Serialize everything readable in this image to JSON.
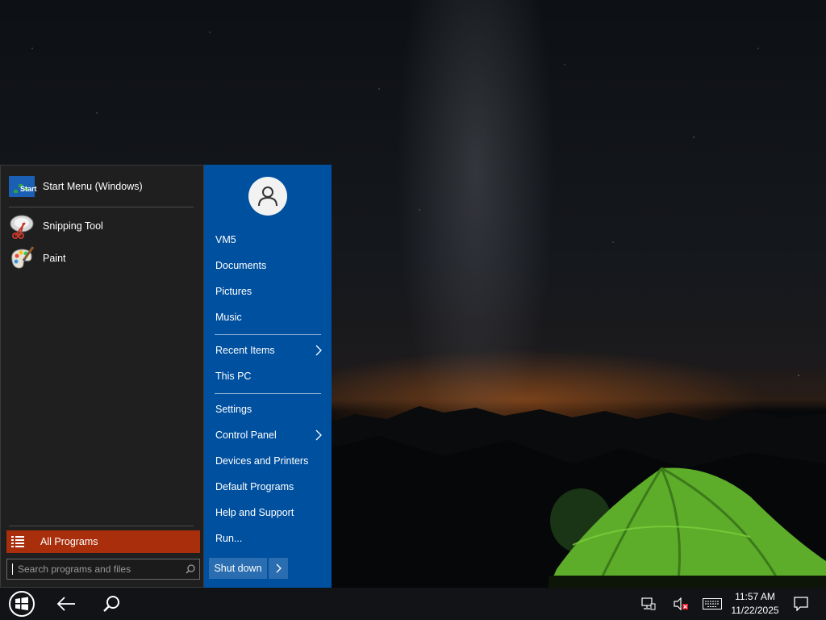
{
  "start_menu": {
    "pinned": [
      {
        "label": "Start Menu (Windows)",
        "icon": "start-menu-app-icon"
      },
      {
        "label": "Snipping Tool",
        "icon": "snipping-tool-icon"
      },
      {
        "label": "Paint",
        "icon": "paint-icon"
      }
    ],
    "start_icon_text": "Start",
    "all_programs_label": "All Programs",
    "search_placeholder": "Search programs and files",
    "right": {
      "user": "VM5",
      "items": [
        "Documents",
        "Pictures",
        "Music",
        "Recent Items",
        "This PC",
        "Settings",
        "Control Panel",
        "Devices and Printers",
        "Default Programs",
        "Help and Support",
        "Run..."
      ],
      "shutdown_label": "Shut down"
    }
  },
  "taskbar": {
    "time": "11:57 AM",
    "date": "11/22/2025",
    "icons": [
      "windows-start-icon",
      "back-arrow-icon",
      "search-icon",
      "network-icon",
      "speaker-muted-icon",
      "keyboard-icon",
      "notification-icon"
    ]
  },
  "colors": {
    "accent_blue": "#0050a0",
    "all_programs_red": "#a82e0c",
    "menu_dark": "#1f1f1f",
    "taskbar": "#111316"
  }
}
